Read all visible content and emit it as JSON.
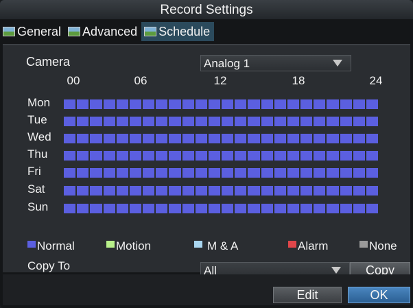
{
  "title": "Record Settings",
  "tabs": [
    {
      "label": "General",
      "active": false
    },
    {
      "label": "Advanced",
      "active": false
    },
    {
      "label": "Schedule",
      "active": true
    }
  ],
  "camera": {
    "label": "Camera",
    "value": "Analog 1"
  },
  "hours": [
    "00",
    "06",
    "12",
    "18",
    "24"
  ],
  "days": [
    "Mon",
    "Tue",
    "Wed",
    "Thu",
    "Fri",
    "Sat",
    "Sun"
  ],
  "schedule_fill": "Normal",
  "legend": [
    {
      "label": "Normal",
      "color": "#5b5fe0"
    },
    {
      "label": "Motion",
      "color": "#b8f08a"
    },
    {
      "label": "M & A",
      "color": "#a9d6f0"
    },
    {
      "label": "Alarm",
      "color": "#e0464a"
    },
    {
      "label": "None",
      "color": "#9a9a9a"
    }
  ],
  "copy_to": {
    "label": "Copy To",
    "value": "All"
  },
  "buttons": {
    "copy": "Copy",
    "edit": "Edit",
    "ok": "OK"
  }
}
